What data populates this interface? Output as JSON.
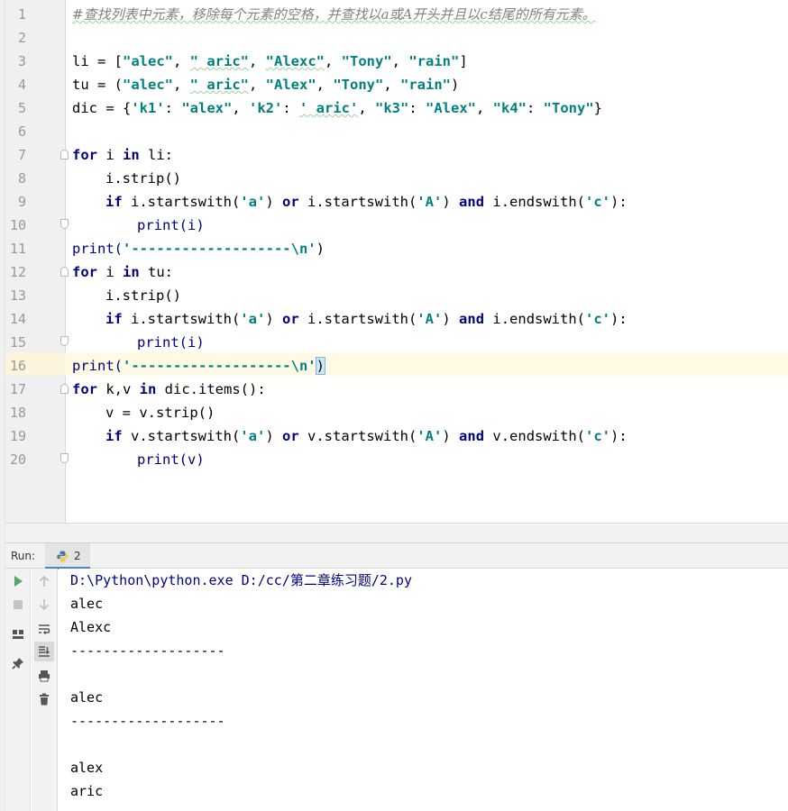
{
  "editor": {
    "line_numbers": [
      "1",
      "2",
      "3",
      "4",
      "5",
      "6",
      "7",
      "8",
      "9",
      "10",
      "11",
      "12",
      "13",
      "14",
      "15",
      "16",
      "17",
      "18",
      "19",
      "20"
    ],
    "comment": "#查找列表中元素，移除每个元素的空格，并查找以a或A开头并且以c结尾的所有元素。",
    "tok": {
      "li": "li",
      "tu": "tu",
      "dic": "dic",
      "assign_open_bracket": " = [",
      "assign_open_paren": " = (",
      "assign_open_brace": " = {",
      "comma": ", ",
      "close_bracket": "]",
      "close_paren": ")",
      "close_brace": "}",
      "colon_sp": ": ",
      "s_alec": "\"alec\"",
      "s_aric": "\" aric\"",
      "s_alexc": "\"Alexc\"",
      "s_tony": "\"Tony\"",
      "s_rain": "\"rain\"",
      "s_alex_up": "\"Alex\"",
      "k_k1": "'k1'",
      "k_k2": "'k2'",
      "s_alex": "\"alex\"",
      "s_aric_sq": "' aric'",
      "k_k3": "\"k3\"",
      "k_k4": "\"k4\"",
      "kw_for": "for",
      "kw_in": "in",
      "kw_if": "if",
      "kw_or": "or",
      "kw_and": "and",
      "for_li_head": " i ",
      "for_li_tail": " li:",
      "for_tu_tail": " tu:",
      "for_dic_head": " k,v ",
      "for_dic_tail": " dic.items():",
      "i_strip": "i.strip()",
      "v_strip": "v = v.strip()",
      "i_sw_open": " i.startswith(",
      "i_ew_open": " i.endswith(",
      "v_sw_open": " v.startswith(",
      "v_ew_open": " v.endswith(",
      "paren_close": ")",
      "paren_close_colon": "):",
      "s_a": "'a'",
      "s_A": "'A'",
      "s_c": "'c'",
      "print_i": "print(i)",
      "print_v": "print(v)",
      "print_open": "print(",
      "print_close": ")",
      "dash_str": "'-------------------\\n'"
    }
  },
  "run": {
    "title": "Run:",
    "tab_label": "2"
  },
  "console": {
    "lines": [
      "D:\\Python\\python.exe D:/cc/第二章练习题/2.py",
      "alec",
      "Alexc",
      "-------------------",
      "",
      "alec",
      "-------------------",
      "",
      "alex",
      "aric"
    ]
  },
  "icons": {
    "run": "run-icon",
    "stop": "stop-icon",
    "layout": "layout-icon",
    "pin": "pin-icon",
    "up": "arrow-up-icon",
    "down": "arrow-down-icon",
    "wrap": "soft-wrap-icon",
    "scroll_end": "scroll-to-end-icon",
    "print": "print-icon",
    "trash": "trash-icon",
    "python": "python-icon"
  },
  "colors": {
    "keyword": "#000080",
    "string": "#008080",
    "comment": "#808080",
    "console_path": "#00008b",
    "run_green": "#59a869",
    "tab_underline": "#4a88c7"
  }
}
